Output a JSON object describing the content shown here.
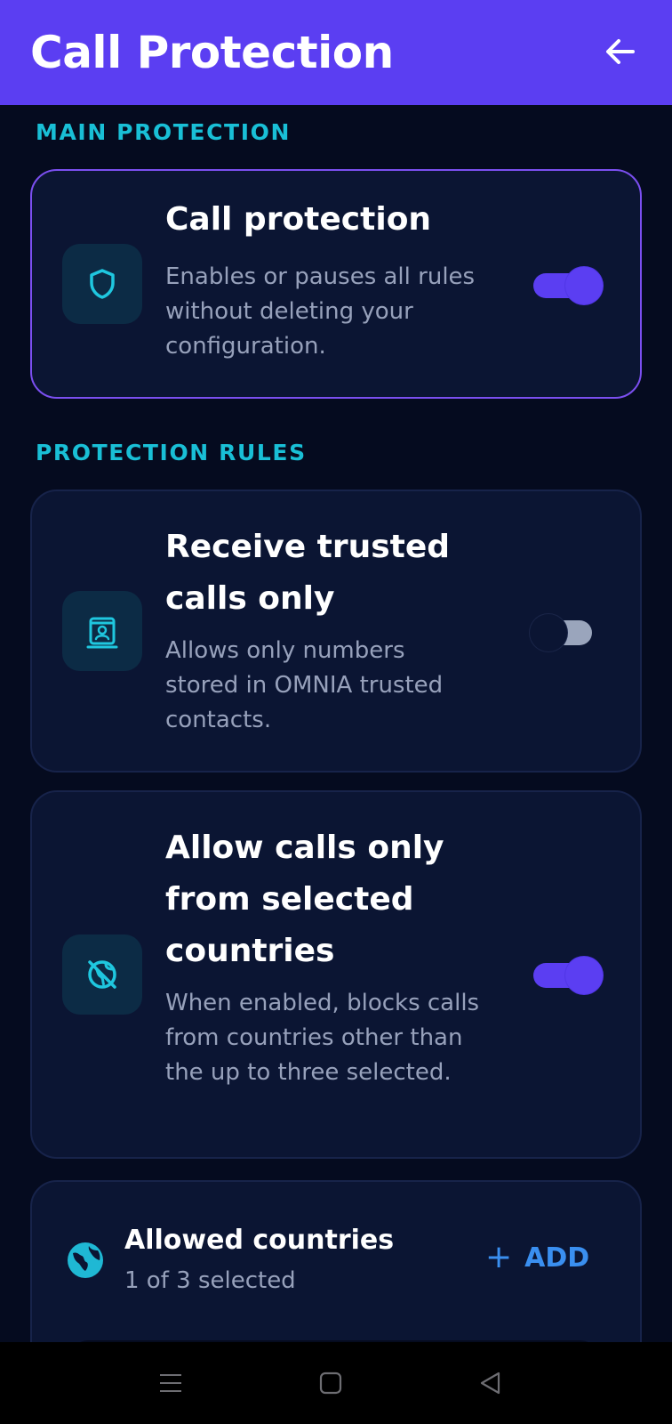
{
  "appbar": {
    "title": "Call Protection",
    "back_icon": "arrow-left-icon",
    "background": "#5b3ef2"
  },
  "sections": {
    "main": "MAIN PROTECTION",
    "rules": "PROTECTION RULES"
  },
  "main_card": {
    "icon": "shield-icon",
    "title": "Call protection",
    "description": "Enables or pauses all rules without deleting your configuration.",
    "enabled": true
  },
  "rules": [
    {
      "icon": "contact-card-icon",
      "title": "Receive trusted calls only",
      "description": "Allows only numbers stored in OMNIA trusted contacts.",
      "enabled": false
    },
    {
      "icon": "globe-off-icon",
      "title": "Allow calls only from selected countries",
      "description": "When enabled, blocks calls from countries other than the up to three selected.",
      "enabled": true
    }
  ],
  "allowed_countries": {
    "icon": "globe-icon",
    "title": "Allowed countries",
    "subtitle": "1 of 3 selected",
    "add_label": "ADD",
    "add_icon": "plus-icon"
  },
  "navbar": {
    "items": [
      "menu-icon",
      "home-square-icon",
      "back-triangle-icon"
    ]
  },
  "colors": {
    "accent": "#5b3ef2",
    "section_label": "#19bfd6",
    "link": "#3a8ff0",
    "background": "#050b1f",
    "card": "#0b1533"
  }
}
